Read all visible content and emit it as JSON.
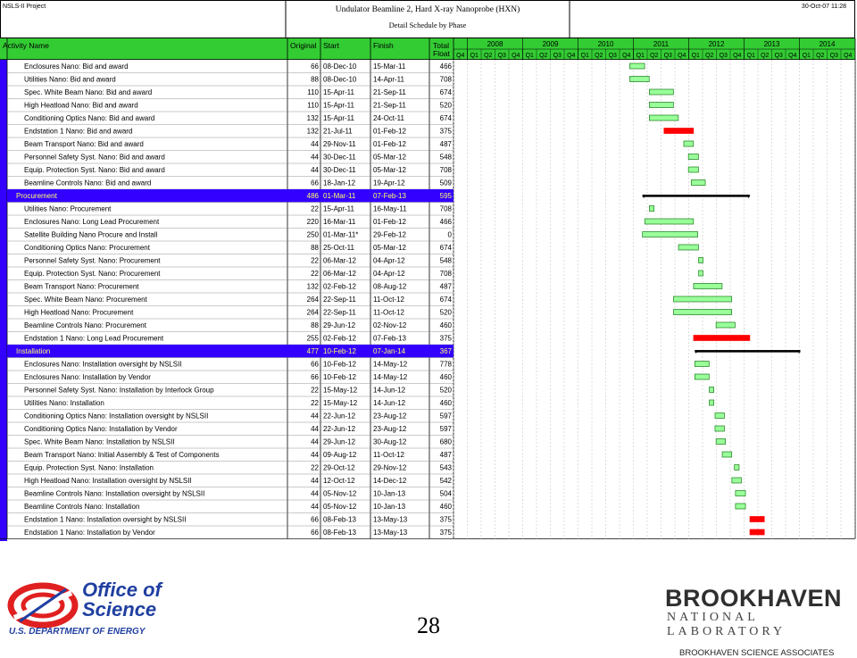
{
  "header": {
    "project": "NSLS-II Project",
    "title": "Undulator Beamline 2, Hard X-ray Nanoprobe (HXN)",
    "subtitle": "Detail Schedule by Phase",
    "date": "30-Oct-07 11:28"
  },
  "columns": {
    "activity": "Activity Name",
    "original": "Original",
    "start": "Start",
    "finish": "Finish",
    "total_float_1": "Total",
    "total_float_2": "Float"
  },
  "colors": {
    "band": "#33cc33",
    "summary": "#3300ff",
    "summary_text": "#ffff66",
    "bar": "#99ff99",
    "critical": "#ff0000",
    "grid": "#c8c8c8"
  },
  "chart_data": {
    "type": "gantt",
    "years": [
      "2008",
      "2009",
      "2010",
      "2011",
      "2012",
      "2013",
      "2014"
    ],
    "quarters": [
      "Q4",
      "Q1",
      "Q2",
      "Q3",
      "Q4",
      "Q1",
      "Q2",
      "Q3",
      "Q4",
      "Q1",
      "Q2",
      "Q3",
      "Q4",
      "Q1",
      "Q2",
      "Q3",
      "Q4",
      "Q1",
      "Q2",
      "Q3",
      "Q4",
      "Q1",
      "Q2",
      "Q3",
      "Q4",
      "Q1",
      "Q2",
      "Q3",
      "Q4"
    ],
    "rows": [
      {
        "name": "Enclosures Nano:  Bid and award",
        "orig": "66",
        "start": "08-Dec-10",
        "finish": "15-Mar-11",
        "float": "466",
        "s": "2010-12-08",
        "f": "2011-03-15",
        "kind": "task"
      },
      {
        "name": "Utilities  Nano:  Bid and award",
        "orig": "88",
        "start": "08-Dec-10",
        "finish": "14-Apr-11",
        "float": "708",
        "s": "2010-12-08",
        "f": "2011-04-14",
        "kind": "task"
      },
      {
        "name": "Spec. White Beam Nano:  Bid and award",
        "orig": "110",
        "start": "15-Apr-11",
        "finish": "21-Sep-11",
        "float": "674",
        "s": "2011-04-15",
        "f": "2011-09-21",
        "kind": "task"
      },
      {
        "name": "High Heatload Nano:  Bid and award",
        "orig": "110",
        "start": "15-Apr-11",
        "finish": "21-Sep-11",
        "float": "520",
        "s": "2011-04-15",
        "f": "2011-09-21",
        "kind": "task"
      },
      {
        "name": "Conditioning Optics Nano:  Bid and award",
        "orig": "132",
        "start": "15-Apr-11",
        "finish": "24-Oct-11",
        "float": "674",
        "s": "2011-04-15",
        "f": "2011-10-24",
        "kind": "task"
      },
      {
        "name": "Endstation 1 Nano:  Bid and award",
        "orig": "132",
        "start": "21-Jul-11",
        "finish": "01-Feb-12",
        "float": "375",
        "s": "2011-07-21",
        "f": "2012-02-01",
        "kind": "critical"
      },
      {
        "name": "Beam Transport  Nano:  Bid and award",
        "orig": "44",
        "start": "29-Nov-11",
        "finish": "01-Feb-12",
        "float": "487",
        "s": "2011-11-29",
        "f": "2012-02-01",
        "kind": "task"
      },
      {
        "name": "Personnel Safety Syst.  Nano:  Bid and award",
        "orig": "44",
        "start": "30-Dec-11",
        "finish": "05-Mar-12",
        "float": "548",
        "s": "2011-12-30",
        "f": "2012-03-05",
        "kind": "task"
      },
      {
        "name": "Equip. Protection Syst.  Nano:  Bid and award",
        "orig": "44",
        "start": "30-Dec-11",
        "finish": "05-Mar-12",
        "float": "708",
        "s": "2011-12-30",
        "f": "2012-03-05",
        "kind": "task"
      },
      {
        "name": "Beamline Controls Nano:  Bid and award",
        "orig": "66",
        "start": "18-Jan-12",
        "finish": "19-Apr-12",
        "float": "509",
        "s": "2012-01-18",
        "f": "2012-04-19",
        "kind": "task"
      },
      {
        "name": "Procurement",
        "orig": "486",
        "start": "01-Mar-11",
        "finish": "07-Feb-13",
        "float": "595",
        "s": "2011-03-01",
        "f": "2013-02-07",
        "kind": "summary"
      },
      {
        "name": "Utilities  Nano:  Procurement",
        "orig": "22",
        "start": "15-Apr-11",
        "finish": "16-May-11",
        "float": "708",
        "s": "2011-04-15",
        "f": "2011-05-16",
        "kind": "task"
      },
      {
        "name": "Enclosures Nano:  Long Lead Procurement",
        "orig": "220",
        "start": "16-Mar-11",
        "finish": "01-Feb-12",
        "float": "466",
        "s": "2011-03-16",
        "f": "2012-02-01",
        "kind": "task"
      },
      {
        "name": "Satellite Building Nano Procure and Install",
        "orig": "250",
        "start": "01-Mar-11*",
        "finish": "29-Feb-12",
        "float": "0",
        "s": "2011-03-01",
        "f": "2012-02-29",
        "kind": "task"
      },
      {
        "name": "Conditioning Optics Nano:  Procurement",
        "orig": "88",
        "start": "25-Oct-11",
        "finish": "05-Mar-12",
        "float": "674",
        "s": "2011-10-25",
        "f": "2012-03-05",
        "kind": "task"
      },
      {
        "name": "Personnel Safety Syst.  Nano:  Procurement",
        "orig": "22",
        "start": "06-Mar-12",
        "finish": "04-Apr-12",
        "float": "548",
        "s": "2012-03-06",
        "f": "2012-04-04",
        "kind": "task"
      },
      {
        "name": "Equip. Protection Syst.  Nano:  Procurement",
        "orig": "22",
        "start": "06-Mar-12",
        "finish": "04-Apr-12",
        "float": "708",
        "s": "2012-03-06",
        "f": "2012-04-04",
        "kind": "task"
      },
      {
        "name": "Beam Transport  Nano:  Procurement",
        "orig": "132",
        "start": "02-Feb-12",
        "finish": "08-Aug-12",
        "float": "487",
        "s": "2012-02-02",
        "f": "2012-08-08",
        "kind": "task"
      },
      {
        "name": "Spec. White Beam Nano:  Procurement",
        "orig": "264",
        "start": "22-Sep-11",
        "finish": "11-Oct-12",
        "float": "674",
        "s": "2011-09-22",
        "f": "2012-10-11",
        "kind": "task"
      },
      {
        "name": "High Heatload Nano:  Procurement",
        "orig": "264",
        "start": "22-Sep-11",
        "finish": "11-Oct-12",
        "float": "520",
        "s": "2011-09-22",
        "f": "2012-10-11",
        "kind": "task"
      },
      {
        "name": "Beamline Controls Nano:  Procurement",
        "orig": "88",
        "start": "29-Jun-12",
        "finish": "02-Nov-12",
        "float": "460",
        "s": "2012-06-29",
        "f": "2012-11-02",
        "kind": "task"
      },
      {
        "name": "Endstation 1 Nano:  Long Lead Procurement",
        "orig": "255",
        "start": "02-Feb-12",
        "finish": "07-Feb-13",
        "float": "375",
        "s": "2012-02-02",
        "f": "2013-02-07",
        "kind": "critical"
      },
      {
        "name": "Installation",
        "orig": "477",
        "start": "10-Feb-12",
        "finish": "07-Jan-14",
        "float": "367",
        "s": "2012-02-10",
        "f": "2014-01-07",
        "kind": "summary"
      },
      {
        "name": "Enclosures Nano:  Installation oversight by NSLSII",
        "orig": "66",
        "start": "10-Feb-12",
        "finish": "14-May-12",
        "float": "778",
        "s": "2012-02-10",
        "f": "2012-05-14",
        "kind": "task"
      },
      {
        "name": "Enclosures Nano:  Installation by Vendor",
        "orig": "66",
        "start": "10-Feb-12",
        "finish": "14-May-12",
        "float": "460",
        "s": "2012-02-10",
        "f": "2012-05-14",
        "kind": "task"
      },
      {
        "name": "Personnel Safety Syst.  Nano:  Installation by Interlock Group",
        "orig": "22",
        "start": "15-May-12",
        "finish": "14-Jun-12",
        "float": "520",
        "s": "2012-05-15",
        "f": "2012-06-14",
        "kind": "task"
      },
      {
        "name": "Utilities  Nano:  Installation",
        "orig": "22",
        "start": "15-May-12",
        "finish": "14-Jun-12",
        "float": "460",
        "s": "2012-05-15",
        "f": "2012-06-14",
        "kind": "task"
      },
      {
        "name": "Conditioning Optics Nano:  Installation oversight by NSLSII",
        "orig": "44",
        "start": "22-Jun-12",
        "finish": "23-Aug-12",
        "float": "597",
        "s": "2012-06-22",
        "f": "2012-08-23",
        "kind": "task"
      },
      {
        "name": "Conditioning Optics Nano:  Installation by Vendor",
        "orig": "44",
        "start": "22-Jun-12",
        "finish": "23-Aug-12",
        "float": "597",
        "s": "2012-06-22",
        "f": "2012-08-23",
        "kind": "task"
      },
      {
        "name": "Spec. White Beam Nano:  Installation by NSLSII",
        "orig": "44",
        "start": "29-Jun-12",
        "finish": "30-Aug-12",
        "float": "680",
        "s": "2012-06-29",
        "f": "2012-08-30",
        "kind": "task"
      },
      {
        "name": "Beam Transport  Nano:  Initial Assembly & Test of Components",
        "orig": "44",
        "start": "09-Aug-12",
        "finish": "11-Oct-12",
        "float": "487",
        "s": "2012-08-09",
        "f": "2012-10-11",
        "kind": "task"
      },
      {
        "name": "Equip. Protection Syst.  Nano:  Installation",
        "orig": "22",
        "start": "29-Oct-12",
        "finish": "29-Nov-12",
        "float": "543",
        "s": "2012-10-29",
        "f": "2012-11-29",
        "kind": "task"
      },
      {
        "name": "High Heatload Nano:  Installation oversight by NSLSII",
        "orig": "44",
        "start": "12-Oct-12",
        "finish": "14-Dec-12",
        "float": "542",
        "s": "2012-10-12",
        "f": "2012-12-14",
        "kind": "task"
      },
      {
        "name": "Beamline Controls Nano:  Installation oversight by NSLSII",
        "orig": "44",
        "start": "05-Nov-12",
        "finish": "10-Jan-13",
        "float": "504",
        "s": "2012-11-05",
        "f": "2013-01-10",
        "kind": "task"
      },
      {
        "name": "Beamline Controls Nano:  Installation",
        "orig": "44",
        "start": "05-Nov-12",
        "finish": "10-Jan-13",
        "float": "460",
        "s": "2012-11-05",
        "f": "2013-01-10",
        "kind": "task"
      },
      {
        "name": "Endstation 1 Nano:  Installation oversight by NSLSII",
        "orig": "66",
        "start": "08-Feb-13",
        "finish": "13-May-13",
        "float": "375",
        "s": "2013-02-08",
        "f": "2013-05-13",
        "kind": "critical"
      },
      {
        "name": "Endstation 1 Nano:  Installation by Vendor",
        "orig": "66",
        "start": "08-Feb-13",
        "finish": "13-May-13",
        "float": "375",
        "s": "2013-02-08",
        "f": "2013-05-13",
        "kind": "critical"
      }
    ]
  },
  "footer": {
    "doe_office": "Office of",
    "doe_science": "Science",
    "doe_dept": "U.S. DEPARTMENT OF ENERGY",
    "page_number": "28",
    "bnl_name": "BROOKHAVEN",
    "bnl_sub": "NATIONAL LABORATORY",
    "bnl_assoc": "BROOKHAVEN SCIENCE ASSOCIATES"
  }
}
